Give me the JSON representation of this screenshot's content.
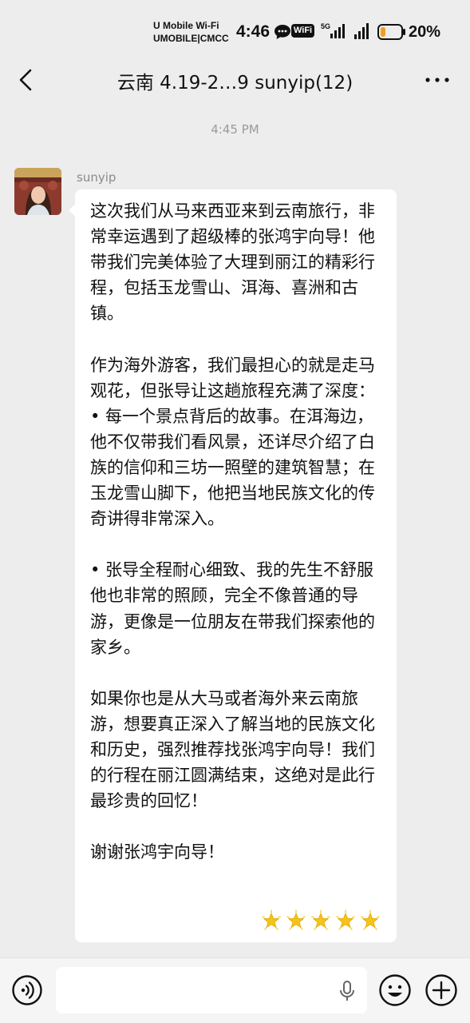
{
  "status_bar": {
    "carrier_line1": "U Mobile Wi-Fi",
    "carrier_line2": "UMOBILE|CMCC",
    "time": "4:46",
    "network_badge": "5G",
    "wifi_badge": "WiFi",
    "battery_percent": "20%",
    "battery_color": "#f0a020"
  },
  "header": {
    "title": "云南 4.19-2…9 sunyip(12)",
    "back_icon": "chevron-left-icon",
    "more_icon": "more-dots-icon"
  },
  "chat": {
    "timestamp": "4:45 PM",
    "message": {
      "sender": "sunyip",
      "paragraphs": [
        "这次我们从马来西亚来到云南旅行，非常幸运遇到了超级棒的张鸿宇向导！他带我们完美体验了大理到丽江的精彩行程，包括玉龙雪山、洱海、喜洲和古镇。",
        "作为海外游客，我们最担心的就是走马观花，但张导让这趟旅程充满了深度：",
        "• 每一个景点背后的故事。在洱海边，他不仅带我们看风景，还详尽介绍了白族的信仰和三坊一照壁的建筑智慧；在玉龙雪山脚下，他把当地民族文化的传奇讲得非常深入。",
        "• 张导全程耐心细致、我的先生不舒服他也非常的照顾，完全不像普通的导游，更像是一位朋友在带我们探索他的家乡。",
        "如果你也是从大马或者海外来云南旅游，想要真正深入了解当地的民族文化和历史，强烈推荐找张鸿宇向导！我们的行程在丽江圆满结束，这绝对是此行最珍贵的回忆！",
        "谢谢张鸿宇向导！"
      ],
      "trailing_emoji_count": 5,
      "trailing_emoji_icon": "glowing-star-icon"
    }
  },
  "input_bar": {
    "voice_icon": "voice-icon",
    "mic_icon": "mic-icon",
    "emoji_icon": "smiley-icon",
    "plus_icon": "plus-icon",
    "input_value": ""
  },
  "colors": {
    "background": "#ededed",
    "bubble": "#ffffff",
    "text": "#111111",
    "secondary_text": "#9a9a9a",
    "star": "#f6c31a"
  }
}
